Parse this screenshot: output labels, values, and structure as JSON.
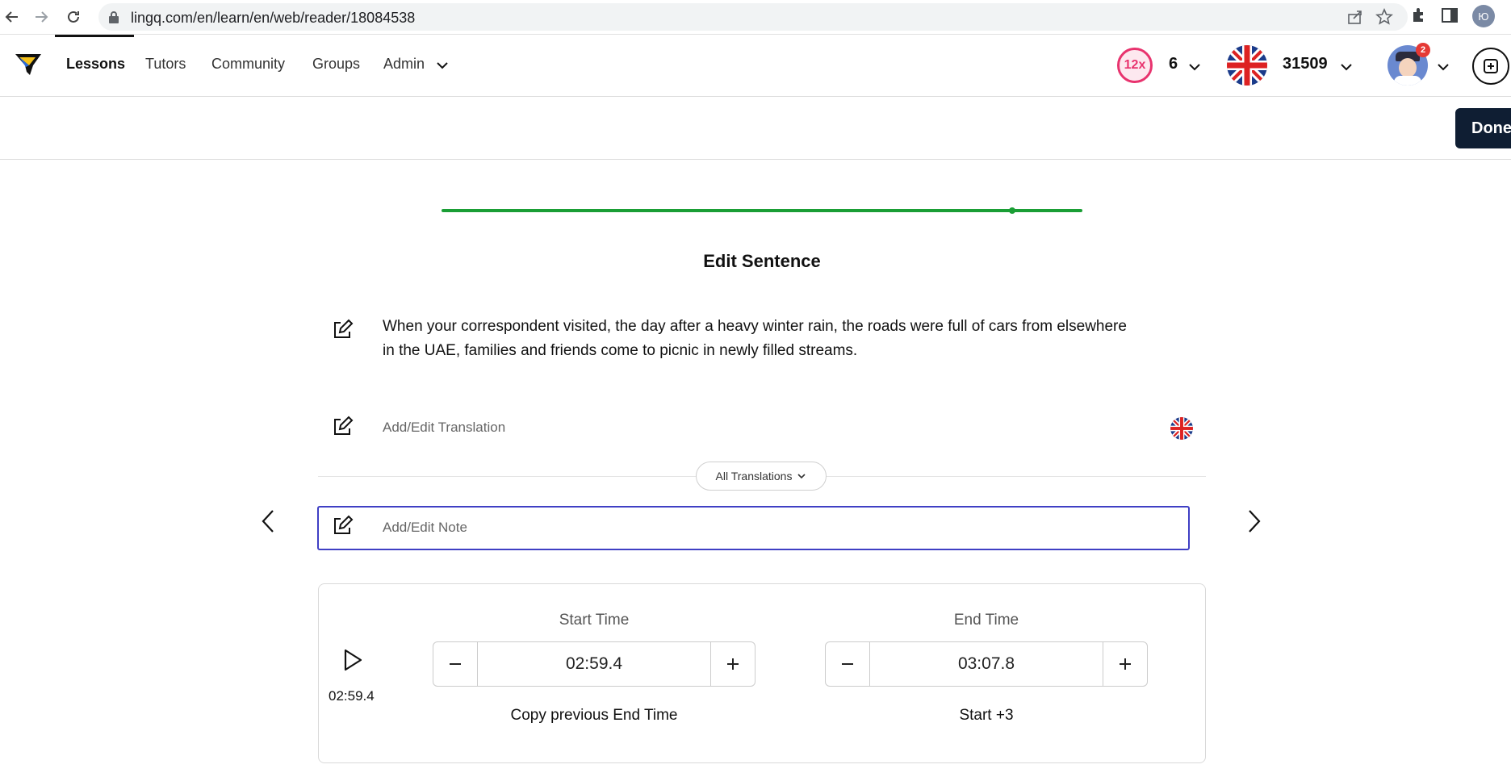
{
  "browser": {
    "url": "lingq.com/en/learn/en/web/reader/18084538",
    "profile_initial": "Ю"
  },
  "header": {
    "nav": [
      {
        "label": "Lessons",
        "active": true
      },
      {
        "label": "Tutors"
      },
      {
        "label": "Community"
      },
      {
        "label": "Groups"
      },
      {
        "label": "Admin"
      }
    ],
    "streak_multiplier": "12x",
    "streak_count": "6",
    "coins": "31509",
    "notification_count": "2"
  },
  "toolbar": {
    "done_label": "Done"
  },
  "editor": {
    "progress_fraction": 0.89,
    "title": "Edit Sentence",
    "sentence": "When your correspondent visited, the day after a heavy winter rain, the roads were full of cars from elsewhere in the UAE, families and friends come to picnic in newly filled streams.",
    "translation_placeholder": "Add/Edit Translation",
    "all_translations_label": "All Translations",
    "note_placeholder": "Add/Edit Note"
  },
  "timing": {
    "current_time": "02:59.4",
    "start": {
      "label": "Start Time",
      "value": "02:59.4",
      "action": "Copy previous End Time"
    },
    "end": {
      "label": "End Time",
      "value": "03:07.8",
      "action": "Start +3"
    }
  },
  "colors": {
    "progress": "#1a9e35",
    "streak": "#e8336e",
    "note_focus": "#3f3fc4",
    "done_bg": "#0f1e33"
  }
}
